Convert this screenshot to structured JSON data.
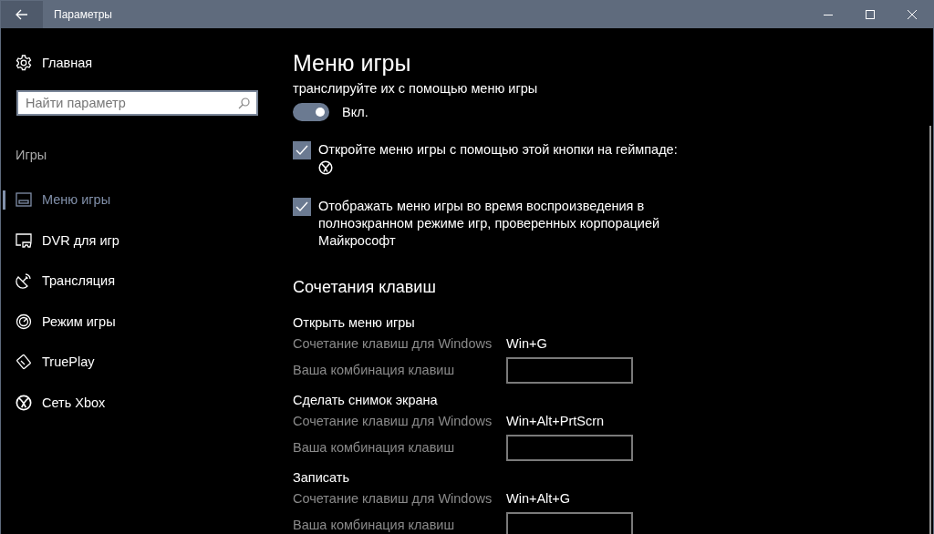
{
  "window": {
    "title": "Параметры"
  },
  "sidebar": {
    "home": "Главная",
    "search": {
      "placeholder": "Найти параметр"
    },
    "group": "Игры",
    "items": [
      {
        "label": "Меню игры",
        "selected": true
      },
      {
        "label": "DVR для игр",
        "selected": false
      },
      {
        "label": "Трансляция",
        "selected": false
      },
      {
        "label": "Режим игры",
        "selected": false
      },
      {
        "label": "TruePlay",
        "selected": false
      },
      {
        "label": "Сеть Xbox",
        "selected": false
      }
    ]
  },
  "content": {
    "title": "Меню игры",
    "intro": "транслируйте их с помощью меню игры",
    "toggle": {
      "on": true,
      "label": "Вкл."
    },
    "checkboxes": [
      {
        "kind": "button-hint",
        "label": "Откройте меню игры с помощью этой кнопки на геймпаде:",
        "checked": true
      },
      {
        "kind": "plain",
        "label": "Отображать меню игры во время воспроизведения в полноэкранном режиме игр, проверенных корпорацией Майкрософт",
        "checked": true
      }
    ],
    "shortcuts": {
      "title": "Сочетания клавиш",
      "groups": [
        {
          "title": "Открыть меню игры",
          "windows_label": "Сочетание клавиш для Windows",
          "windows_keys": "Win+G",
          "custom_label": "Ваша комбинация клавиш"
        },
        {
          "title": "Сделать снимок экрана",
          "windows_label": "Сочетание клавиш для Windows",
          "windows_keys": "Win+Alt+PrtScrn",
          "custom_label": "Ваша комбинация клавиш"
        },
        {
          "title": "Записать",
          "windows_label": "Сочетание клавиш для Windows",
          "windows_keys": "Win+Alt+G",
          "custom_label": "Ваша комбинация клавиш"
        }
      ]
    }
  }
}
